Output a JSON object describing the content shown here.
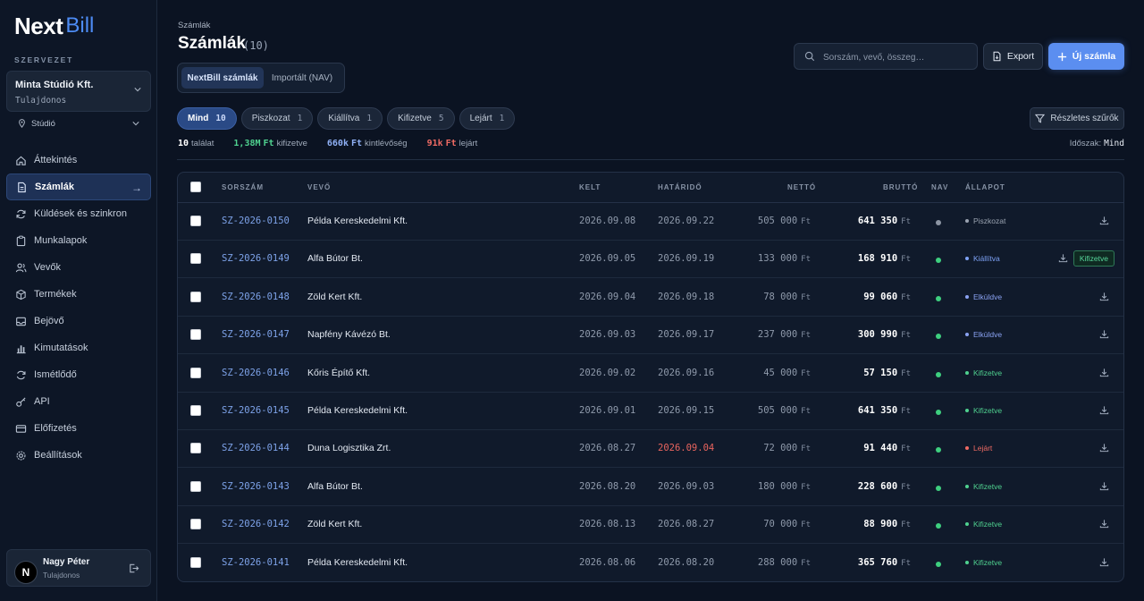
{
  "app": {
    "logo_main": "Next",
    "logo_sub": "Bill"
  },
  "sidebar": {
    "org_section_label": "SZERVEZET",
    "org_name": "Minta Stúdió Kft.",
    "org_role": "Tulajdonos",
    "workspace": "Stúdió",
    "items": [
      {
        "label": "Áttekintés",
        "icon": "home-icon"
      },
      {
        "label": "Számlák",
        "icon": "document-icon",
        "active": true
      },
      {
        "label": "Küldések és szinkron",
        "icon": "sync-icon"
      },
      {
        "label": "Munkalapok",
        "icon": "clipboard-icon"
      },
      {
        "label": "Vevők",
        "icon": "users-icon"
      },
      {
        "label": "Termékek",
        "icon": "box-icon"
      },
      {
        "label": "Bejövő",
        "icon": "inbox-icon"
      },
      {
        "label": "Kimutatások",
        "icon": "bar-chart-icon"
      },
      {
        "label": "Ismétlődő",
        "icon": "repeat-icon"
      },
      {
        "label": "API",
        "icon": "key-icon"
      },
      {
        "label": "Előfizetés",
        "icon": "card-icon"
      },
      {
        "label": "Beállítások",
        "icon": "gear-icon"
      }
    ],
    "user": {
      "initial": "N",
      "name": "Nagy Péter",
      "role": "Tulajdonos"
    }
  },
  "header": {
    "breadcrumb": "Számlák",
    "title": "Számlák",
    "count": "(10)",
    "tabs": {
      "active": "NextBill számlák",
      "inactive": "Importált (NAV)"
    },
    "search_placeholder": "Sorszám, vevő, összeg…",
    "export_label": "Export",
    "new_label": "Új számla"
  },
  "filters": {
    "chips": [
      {
        "label": "Mind",
        "count": "10",
        "active": true
      },
      {
        "label": "Piszkozat",
        "count": "1"
      },
      {
        "label": "Kiállítva",
        "count": "1"
      },
      {
        "label": "Kifizetve",
        "count": "5"
      },
      {
        "label": "Lejárt",
        "count": "1"
      }
    ],
    "detailed_label": "Részletes szűrők"
  },
  "summary": {
    "results_num": "10",
    "results_label": "találat",
    "paid_num": "1,38M",
    "paid_unit": "Ft",
    "paid_label": "kifizetve",
    "outstanding_num": "660k",
    "outstanding_unit": "Ft",
    "outstanding_label": "kintlévőség",
    "overdue_num": "91k",
    "overdue_unit": "Ft",
    "overdue_label": "lejárt",
    "period_label": "Időszak:",
    "period_value": "Mind"
  },
  "table": {
    "columns": [
      "SORSZÁM",
      "VEVŐ",
      "KELT",
      "HATÁRIDŐ",
      "NETTÓ",
      "BRUTTÓ",
      "NAV",
      "ÁLLAPOT"
    ],
    "currency": "Ft",
    "paid_action_label": "Kifizetve",
    "rows": [
      {
        "no": "SZ-2026-0150",
        "buyer": "Példa Kereskedelmi Kft.",
        "date": "2026.09.08",
        "due": "2026.09.22",
        "net": "505 000",
        "gross": "641 350",
        "nav": "gray",
        "status": "Piszkozat",
        "status_color": "#9aa3b1",
        "overdue": false,
        "extra": false
      },
      {
        "no": "SZ-2026-0149",
        "buyer": "Alfa Bútor Bt.",
        "date": "2026.09.05",
        "due": "2026.09.19",
        "net": "133 000",
        "gross": "168 910",
        "nav": "green",
        "status": "Kiállítva",
        "status_color": "#7ea2f5",
        "overdue": false,
        "extra": true
      },
      {
        "no": "SZ-2026-0148",
        "buyer": "Zöld Kert Kft.",
        "date": "2026.09.04",
        "due": "2026.09.18",
        "net": "78 000",
        "gross": "99 060",
        "nav": "green",
        "status": "Elküldve",
        "status_color": "#8aa2f2",
        "overdue": false,
        "extra": false
      },
      {
        "no": "SZ-2026-0147",
        "buyer": "Napfény Kávézó Bt.",
        "date": "2026.09.03",
        "due": "2026.09.17",
        "net": "237 000",
        "gross": "300 990",
        "nav": "green",
        "status": "Elküldve",
        "status_color": "#8aa2f2",
        "overdue": false,
        "extra": false
      },
      {
        "no": "SZ-2026-0146",
        "buyer": "Kőris Építő Kft.",
        "date": "2026.09.02",
        "due": "2026.09.16",
        "net": "45 000",
        "gross": "57 150",
        "nav": "green",
        "status": "Kifizetve",
        "status_color": "#4fd18f",
        "overdue": false,
        "extra": false
      },
      {
        "no": "SZ-2026-0145",
        "buyer": "Példa Kereskedelmi Kft.",
        "date": "2026.09.01",
        "due": "2026.09.15",
        "net": "505 000",
        "gross": "641 350",
        "nav": "green",
        "status": "Kifizetve",
        "status_color": "#4fd18f",
        "overdue": false,
        "extra": false
      },
      {
        "no": "SZ-2026-0144",
        "buyer": "Duna Logisztika Zrt.",
        "date": "2026.08.27",
        "due": "2026.09.04",
        "net": "72 000",
        "gross": "91 440",
        "nav": "green",
        "status": "Lejárt",
        "status_color": "#ee6a63",
        "overdue": true,
        "extra": false
      },
      {
        "no": "SZ-2026-0143",
        "buyer": "Alfa Bútor Bt.",
        "date": "2026.08.20",
        "due": "2026.09.03",
        "net": "180 000",
        "gross": "228 600",
        "nav": "green",
        "status": "Kifizetve",
        "status_color": "#4fd18f",
        "overdue": false,
        "extra": false
      },
      {
        "no": "SZ-2026-0142",
        "buyer": "Zöld Kert Kft.",
        "date": "2026.08.13",
        "due": "2026.08.27",
        "net": "70 000",
        "gross": "88 900",
        "nav": "green",
        "status": "Kifizetve",
        "status_color": "#4fd18f",
        "overdue": false,
        "extra": false
      },
      {
        "no": "SZ-2026-0141",
        "buyer": "Példa Kereskedelmi Kft.",
        "date": "2026.08.06",
        "due": "2026.08.20",
        "net": "288 000",
        "gross": "365 760",
        "nav": "green",
        "status": "Kifizetve",
        "status_color": "#4fd18f",
        "overdue": false,
        "extra": false
      }
    ]
  },
  "colors": {
    "accent": "#5b8ef0",
    "nav_green": "#3ecf7f",
    "nav_gray": "#8c95a3",
    "paid": "#4fd18f",
    "outstanding": "#8fb0f5",
    "overdue": "#ee6a63"
  }
}
